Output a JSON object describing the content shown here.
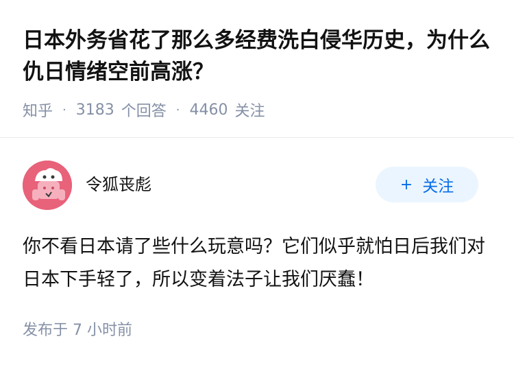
{
  "question": {
    "title": "日本外务省花了那么多经费洗白侵华历史，为什么仇日情绪空前高涨？",
    "source": "知乎",
    "answer_count": "3183",
    "answer_label": "个回答",
    "follower_count": "4460",
    "follower_label": "关注"
  },
  "answer": {
    "author_name": "令狐丧彪",
    "follow_label": "关注",
    "follow_plus": "+",
    "content": "你不看日本请了些什么玩意吗？它们似乎就怕日后我们对日本下手轻了，所以变着法子让我们厌蠢！",
    "published_time": "发布于 7 小时前"
  },
  "colors": {
    "accent": "#056de8",
    "muted_text": "#8590a6",
    "follow_bg": "#ebf5ff",
    "avatar_bg": "#e8627a"
  },
  "icons": {
    "avatar": "cartoon-avatar"
  }
}
